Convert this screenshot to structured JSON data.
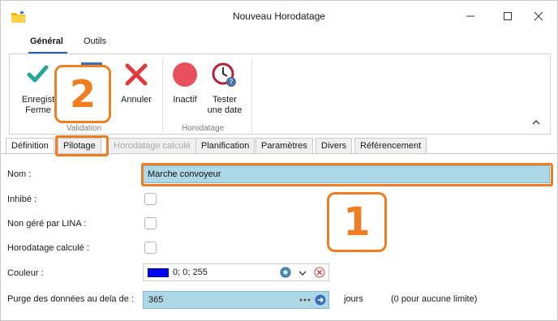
{
  "window": {
    "title": "Nouveau Horodatage",
    "minimize": "—",
    "maximize": "☐",
    "close": "✕"
  },
  "ribbon_tabs": [
    "Général",
    "Outils"
  ],
  "ribbon": {
    "buttons": {
      "enregistrer_line1": "Enregist",
      "enregistrer_line2": "Ferme",
      "hidden_label": "r",
      "annuler": "Annuler",
      "inactif": "Inactif",
      "tester_line1": "Tester",
      "tester_line2": "une date"
    },
    "groups": [
      "Validation",
      "Horodatage"
    ],
    "colors": {
      "accept": "#26a69a",
      "cancel": "#e0393e",
      "inactive": "#e85060",
      "clock": "#b0243a"
    }
  },
  "form_tabs": [
    "Définition",
    "Pilotage",
    "Horodatage calculé",
    "Planification",
    "Paramètres",
    "Divers",
    "Référencement"
  ],
  "form": {
    "nom_label": "Nom :",
    "nom_value": "Marche convoyeur",
    "inhibe_label": "Inhibé :",
    "non_gere_label": "Non géré par LINA :",
    "horodatage_calcule_label": "Horodatage calculé :",
    "couleur_label": "Couleur :",
    "couleur_value": "0; 0; 255",
    "couleur_swatch": "#0000ff",
    "purge_label": "Purge des données au dela de :",
    "purge_value": "365",
    "purge_unit": "jours",
    "purge_hint": "(0 pour aucune limite)"
  },
  "annotations": {
    "one": "1",
    "two": "2",
    "color": "#ef7d22"
  }
}
